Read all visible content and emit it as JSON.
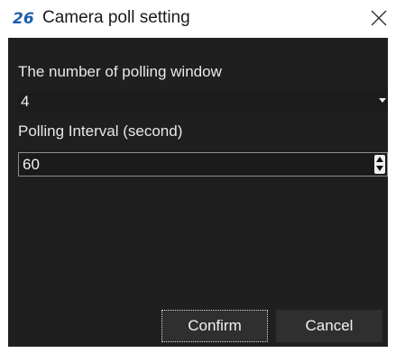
{
  "window": {
    "logo_text": "26",
    "title": "Camera poll setting",
    "close_glyph": "✕"
  },
  "form": {
    "windows_label": "The number of polling window",
    "windows_value": "4",
    "interval_label": "Polling Interval (second)",
    "interval_value": "60"
  },
  "buttons": {
    "confirm": "Confirm",
    "cancel": "Cancel"
  },
  "icons": {
    "logo": "app-logo-icon",
    "close": "close-icon",
    "dropdown": "chevron-down-icon",
    "spin_up": "spin-up-icon",
    "spin_down": "spin-down-icon"
  },
  "colors": {
    "panel_bg": "#1f1f1f",
    "button_bg": "#2f2f2f",
    "text": "#e8e8e8",
    "logo_blue": "#1c5da8"
  }
}
